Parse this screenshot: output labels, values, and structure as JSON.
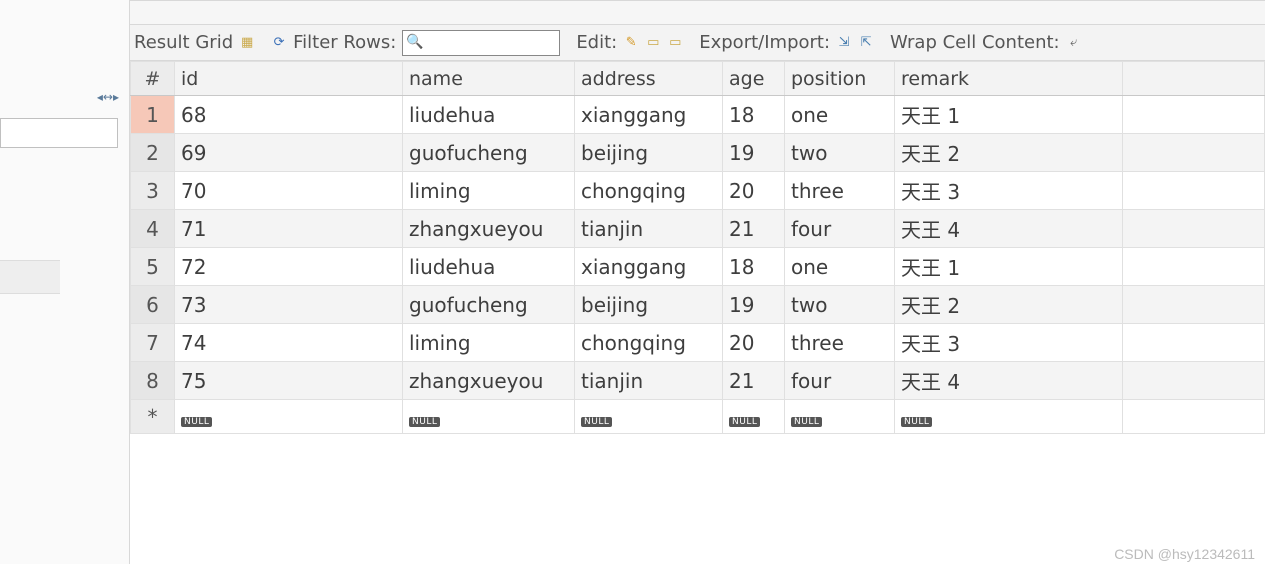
{
  "toolbar": {
    "result_grid_label": "Result Grid",
    "filter_label": "Filter Rows:",
    "filter_value": "",
    "edit_label": "Edit:",
    "export_label": "Export/Import:",
    "wrap_label": "Wrap Cell Content:"
  },
  "columns": {
    "rownum": "#",
    "id": "id",
    "name": "name",
    "address": "address",
    "age": "age",
    "position": "position",
    "remark": "remark"
  },
  "rows": [
    {
      "n": "1",
      "id": "68",
      "name": "liudehua",
      "address": "xianggang",
      "age": "18",
      "position": "one",
      "remark": "天王 1"
    },
    {
      "n": "2",
      "id": "69",
      "name": "guofucheng",
      "address": "beijing",
      "age": "19",
      "position": "two",
      "remark": "天王 2"
    },
    {
      "n": "3",
      "id": "70",
      "name": "liming",
      "address": "chongqing",
      "age": "20",
      "position": "three",
      "remark": "天王 3"
    },
    {
      "n": "4",
      "id": "71",
      "name": "zhangxueyou",
      "address": "tianjin",
      "age": "21",
      "position": "four",
      "remark": "天王 4"
    },
    {
      "n": "5",
      "id": "72",
      "name": "liudehua",
      "address": "xianggang",
      "age": "18",
      "position": "one",
      "remark": "天王 1"
    },
    {
      "n": "6",
      "id": "73",
      "name": "guofucheng",
      "address": "beijing",
      "age": "19",
      "position": "two",
      "remark": "天王 2"
    },
    {
      "n": "7",
      "id": "74",
      "name": "liming",
      "address": "chongqing",
      "age": "20",
      "position": "three",
      "remark": "天王 3"
    },
    {
      "n": "8",
      "id": "75",
      "name": "zhangxueyou",
      "address": "tianjin",
      "age": "21",
      "position": "four",
      "remark": "天王 4"
    }
  ],
  "new_row_marker": "*",
  "null_label": "NULL",
  "watermark": "CSDN @hsy12342611"
}
